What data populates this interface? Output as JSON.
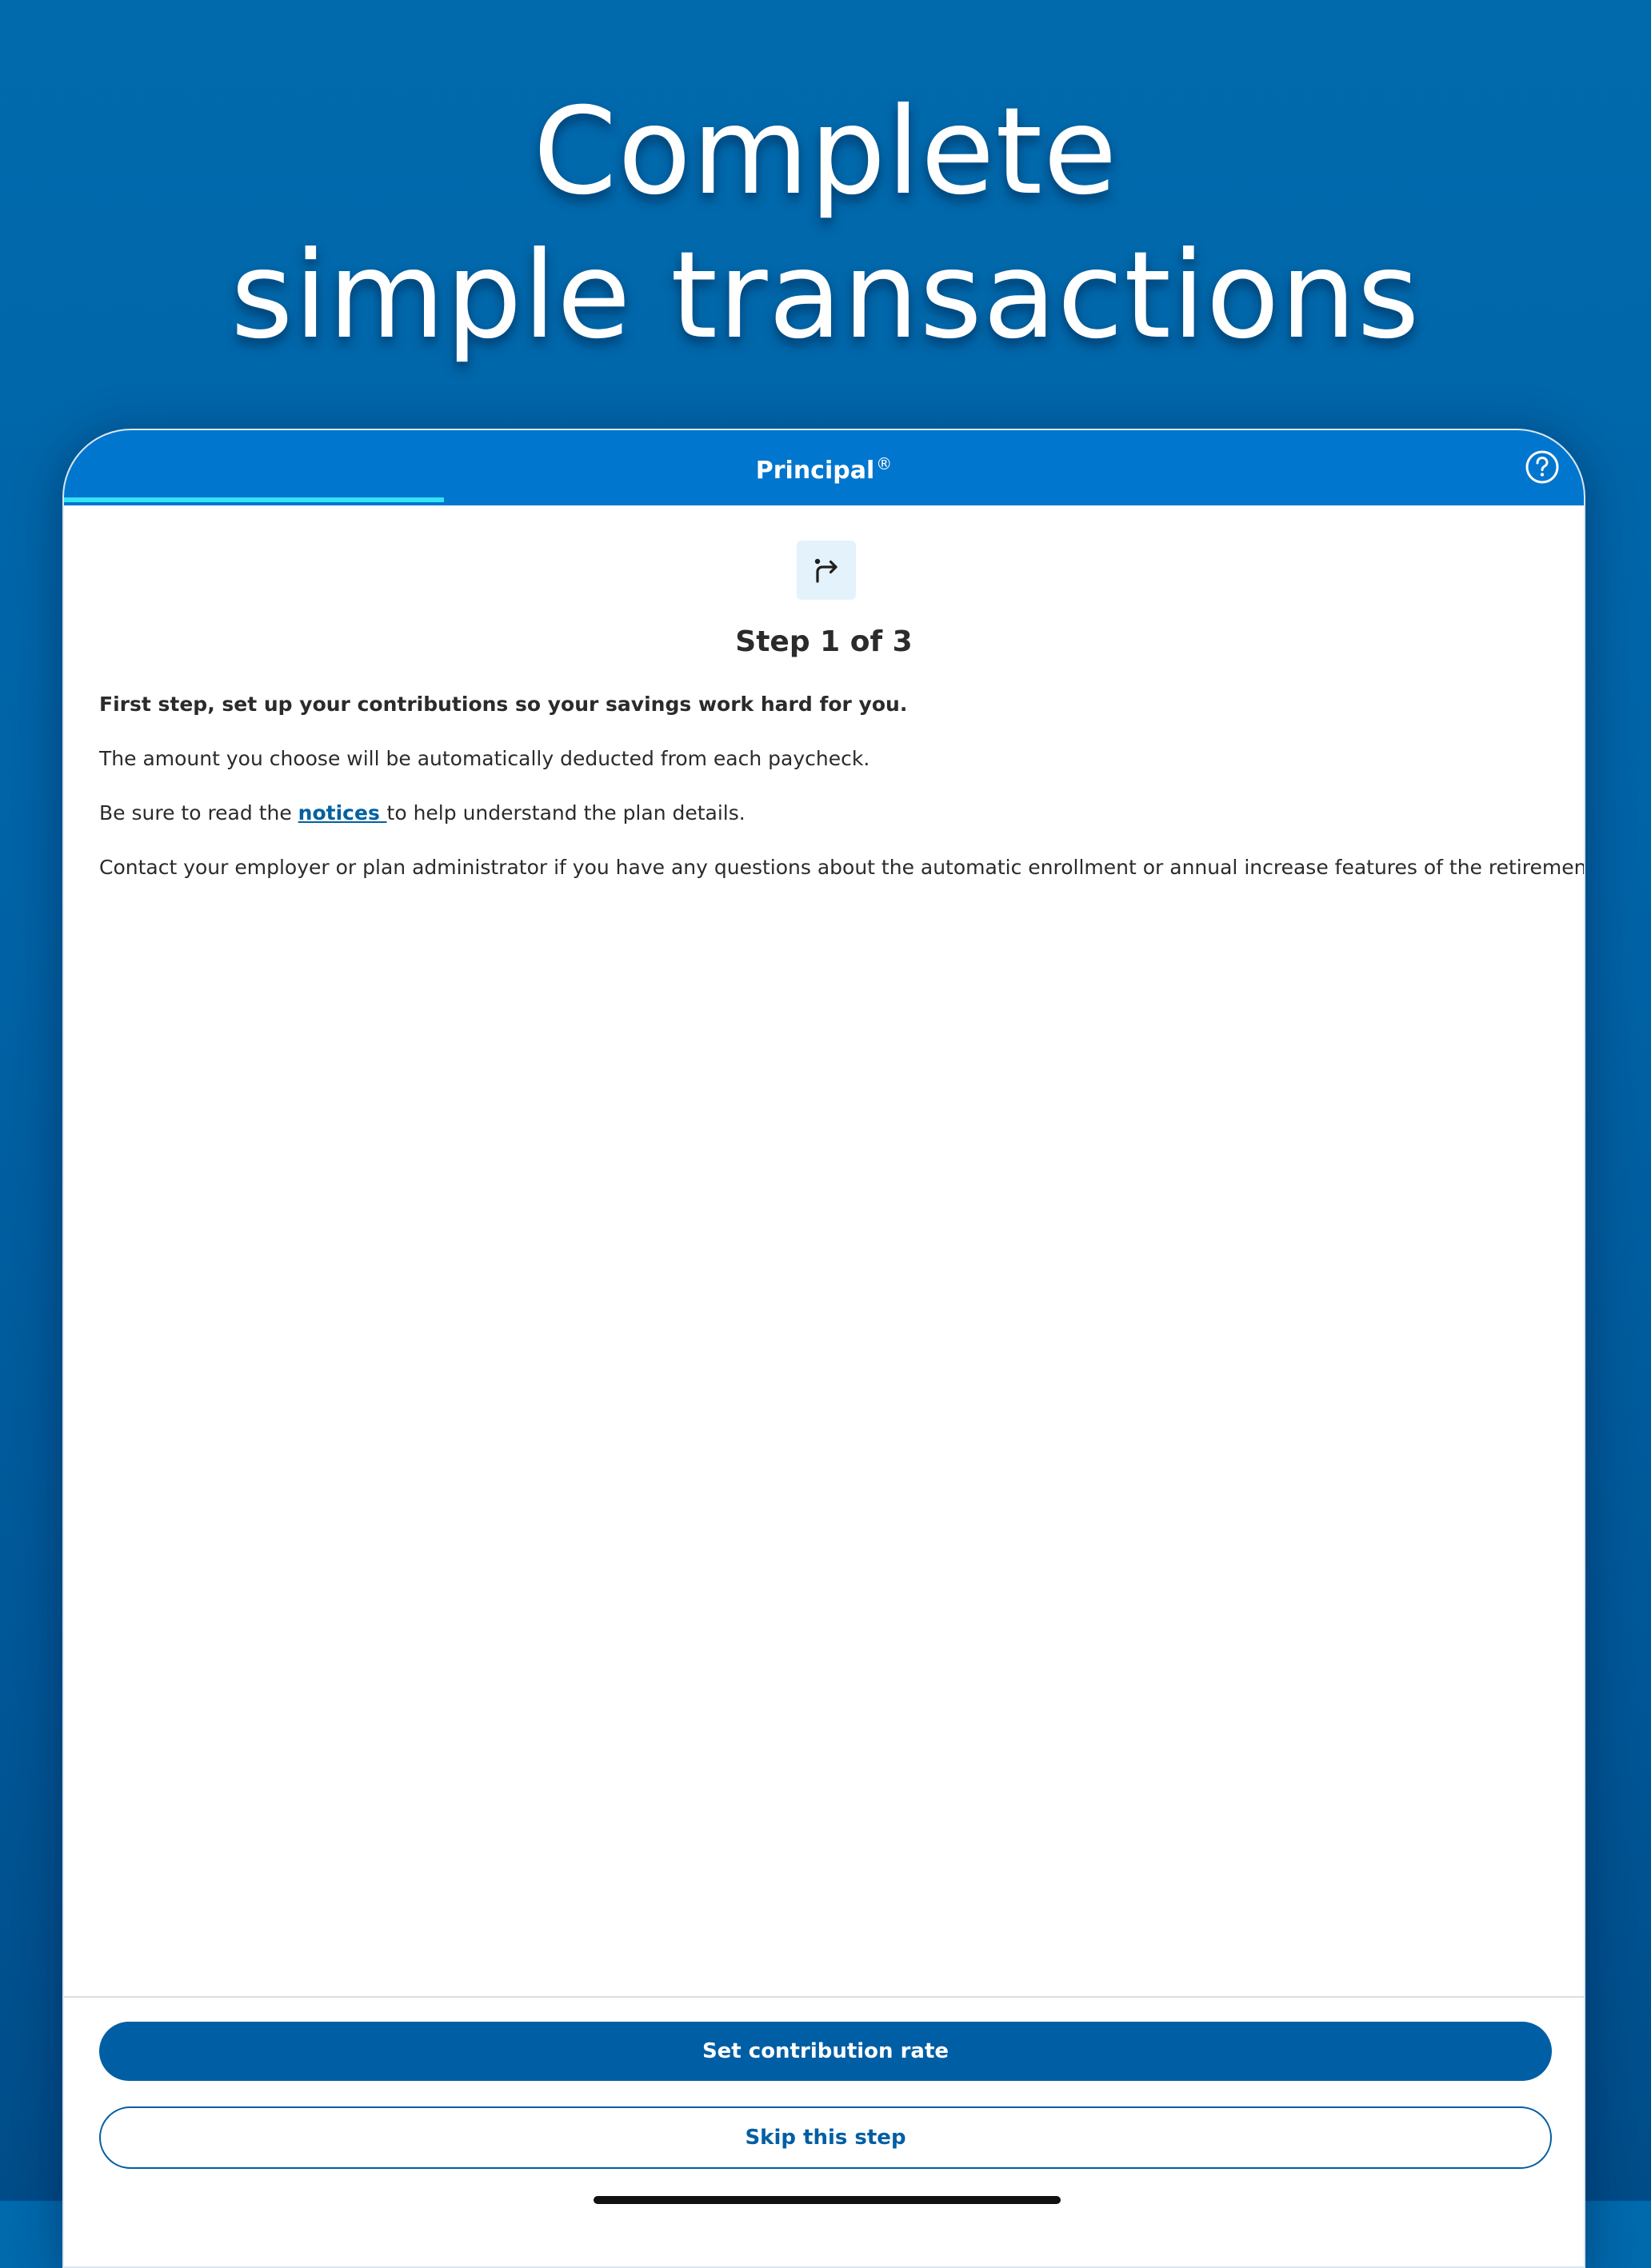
{
  "hero": {
    "line1": "Complete",
    "line2": "simple transactions"
  },
  "app": {
    "brand": "Principal",
    "brand_mark": "®",
    "help_icon": "help-circle-icon",
    "progress": 0.25,
    "colors": {
      "header": "#0076cf",
      "progress": "#34e3f5",
      "primary": "#005ea4",
      "link": "#0061a0"
    }
  },
  "step": {
    "icon": "turn-right-arrow-icon",
    "title": "Step 1 of 3",
    "intro": "First step, set up your contributions so your savings work hard for you.",
    "paragraph1": "The amount you choose will be automatically deducted from each paycheck.",
    "paragraph2_before": "Be sure to read the ",
    "paragraph2_link": "notices ",
    "paragraph2_after": "to help understand the plan details.",
    "paragraph3": "Contact your employer or plan administrator if you have any questions about the automatic enrollment or annual increase features of the retirement plan."
  },
  "actions": {
    "primary_label": "Set contribution rate",
    "secondary_label": "Skip this step"
  }
}
